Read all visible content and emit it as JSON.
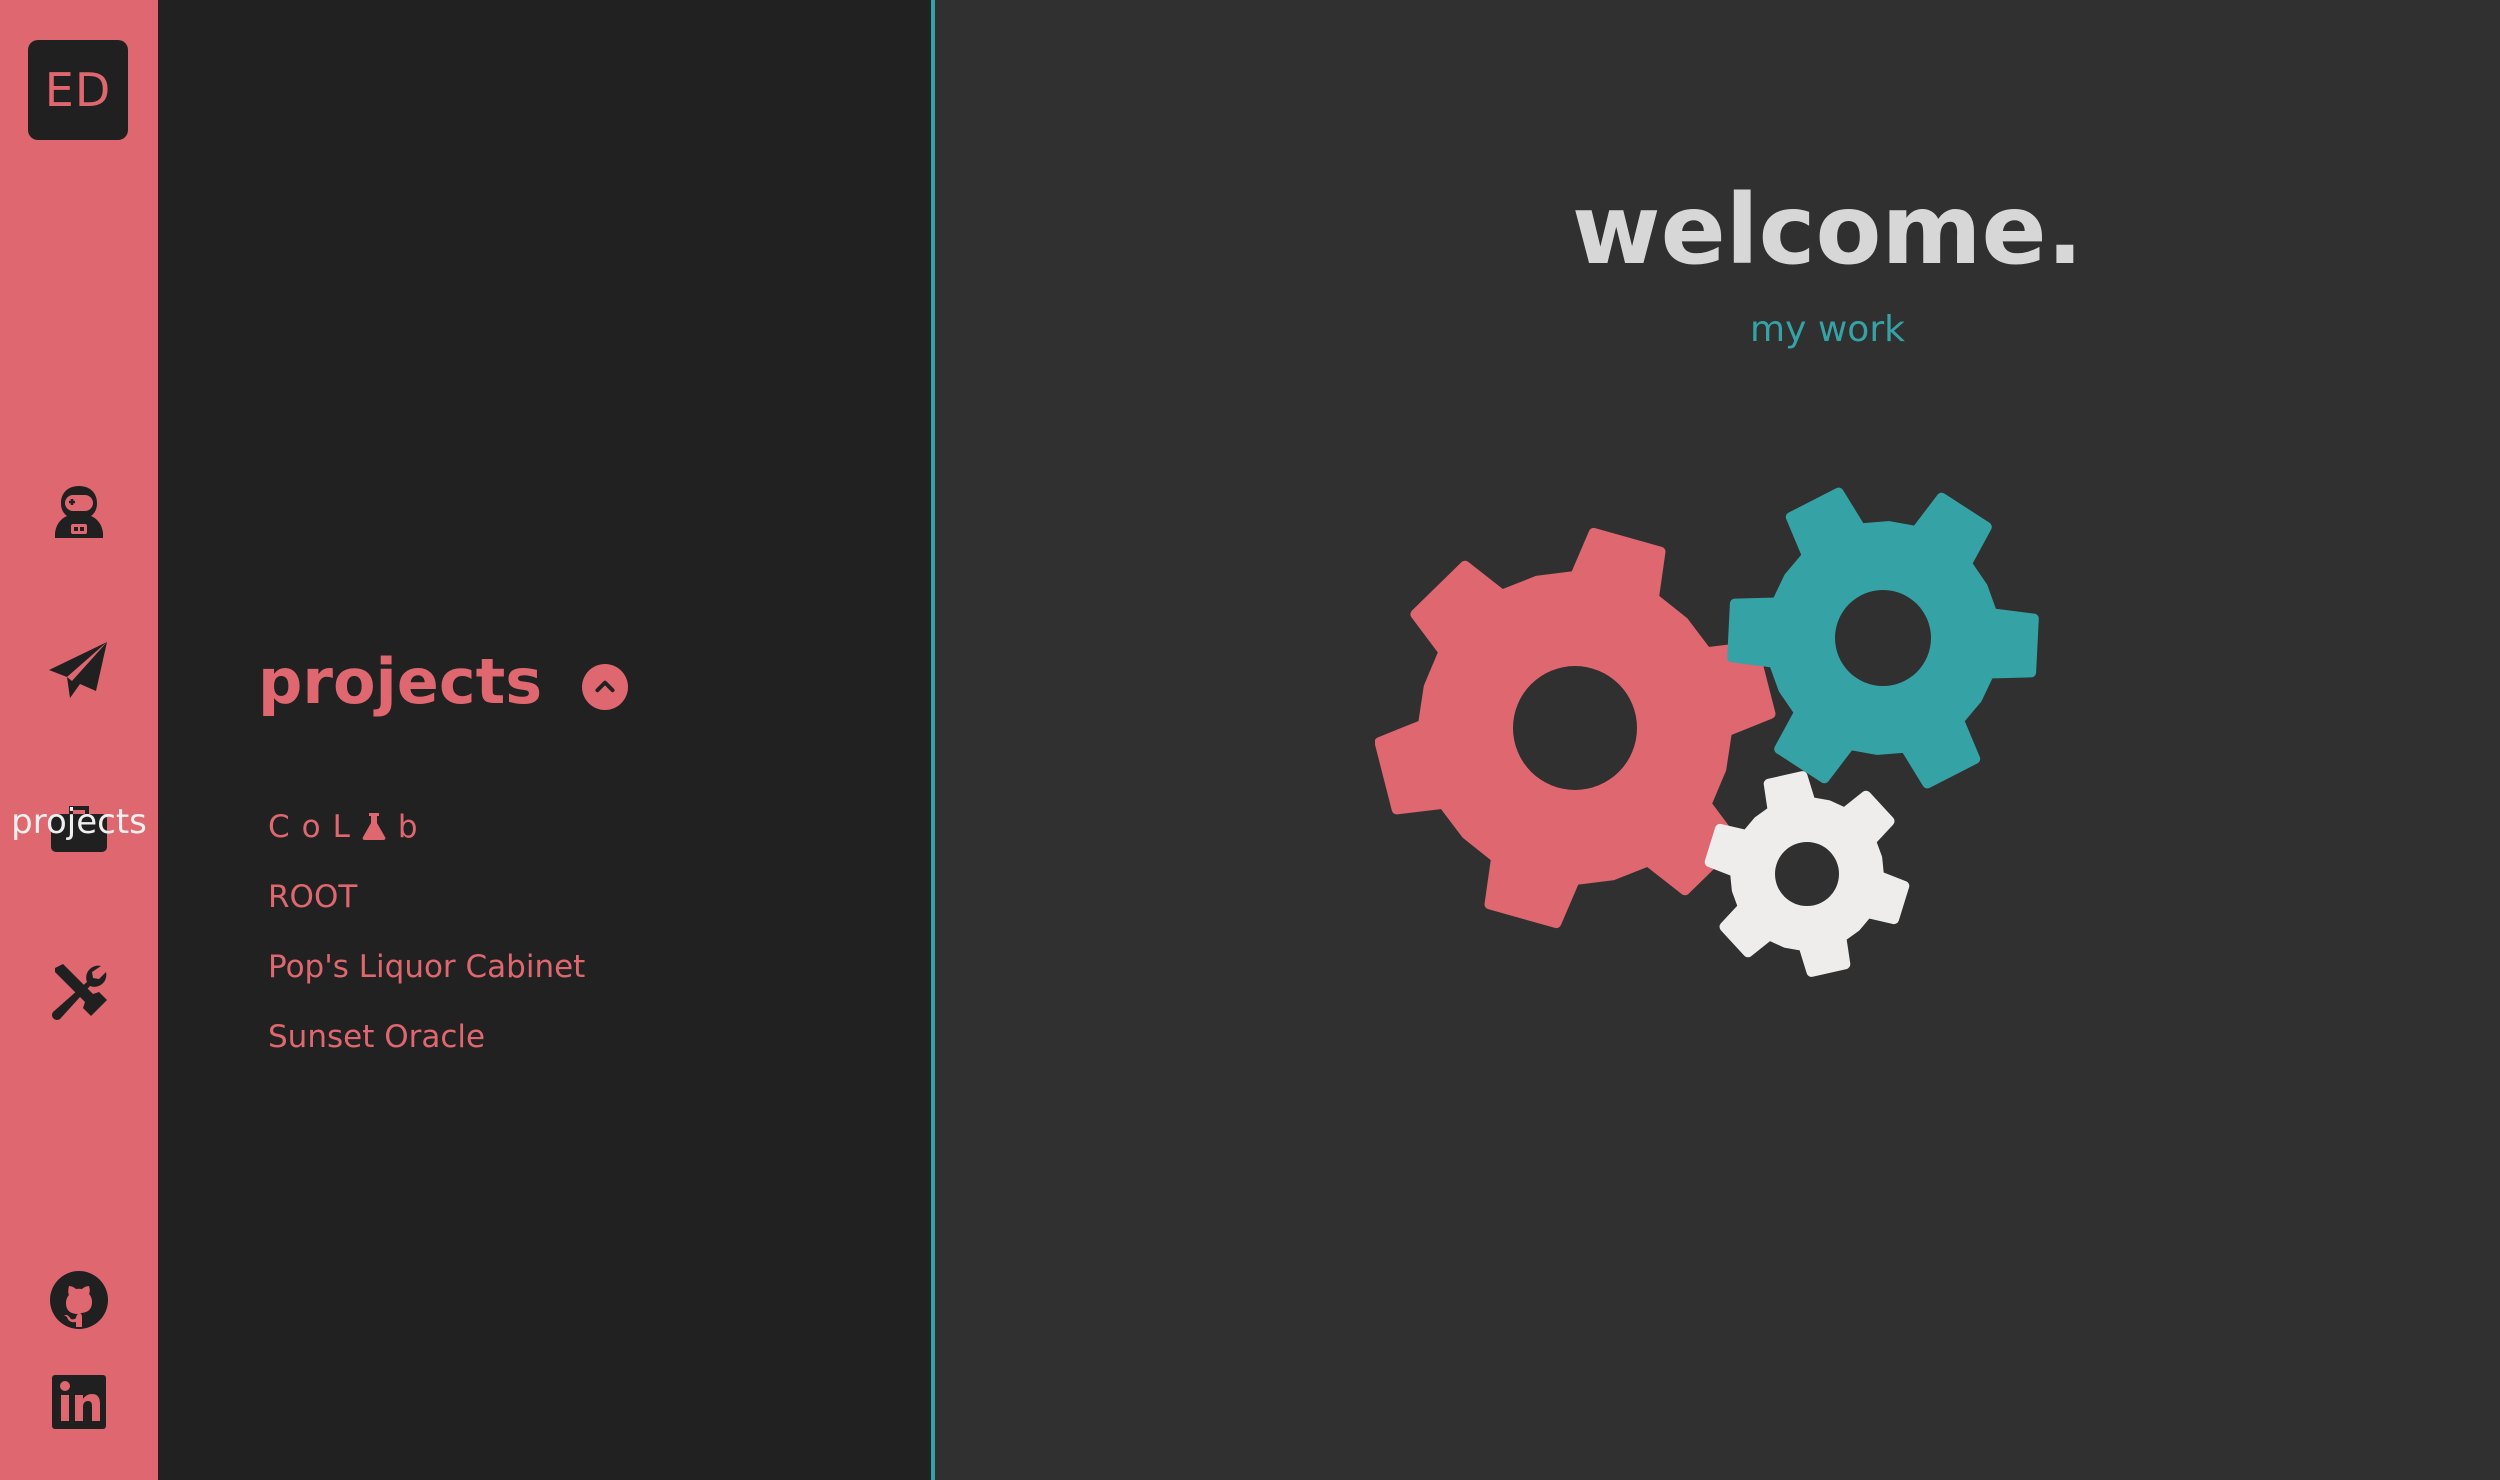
{
  "rail": {
    "logo": "ED",
    "tooltip": "projects",
    "icons": [
      "astronaut-icon",
      "paper-plane-icon",
      "briefcase-icon",
      "tools-icon",
      "github-icon",
      "linkedin-icon"
    ]
  },
  "panel": {
    "title": "projects",
    "toggle_icon": "chevron-up-circle-icon",
    "projects": [
      {
        "label_parts": [
          "CoL",
          "b"
        ],
        "icon": "flask-icon"
      },
      {
        "label": "ROOT"
      },
      {
        "label": "Pop's Liquor Cabinet"
      },
      {
        "label": "Sunset Oracle"
      }
    ]
  },
  "main": {
    "heading": "welcome.",
    "subheading": "my work",
    "illustration": "gears-illustration"
  },
  "colors": {
    "accent": "#df676f",
    "teal": "#35a3a6",
    "panel_bg": "#212121",
    "main_bg": "#303030",
    "gear_light": "#efedec"
  }
}
